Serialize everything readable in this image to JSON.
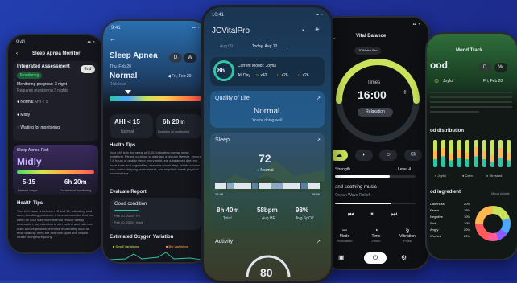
{
  "p1": {
    "title": "Sleep Apnea Monitor",
    "integrated": "Integrated Assessment",
    "end_btn": "End",
    "badge": "Monitoring",
    "progress": "Monitoring progress: 3 night",
    "progress_sub": "Requires monitoring 3 nights",
    "items": [
      "Normal",
      "Midly",
      "Waiting for monitoring"
    ],
    "item_note": "AHI < 5",
    "risk_label": "Sleep Apnea Risk",
    "risk_value": "Midly",
    "ahi_range": "5-15",
    "ahi_sub": "Interval range",
    "duration": "6h 20m",
    "duration_sub": "Duration of monitoring",
    "tips_title": "Health Tips",
    "tips_text": "Your AHI value is between 15 and 15, indicating mild sleep breathing problems. It is recommended that you sleep on your side more often to reduce airway obstruction; pay attention to diet control and eat more fruits and vegetables; exercise moderately such as brisk walking; keep the bedroom quiet and reduce health changes regularly."
  },
  "p2": {
    "title": "Sleep Apnea",
    "seg": [
      "D",
      "W"
    ],
    "date": "Thu, Feb 20",
    "status": "Normal",
    "date_nav": "Fri, Feb 20",
    "range_sub": "Risk level",
    "ahi": "AHI < 15",
    "ahi_sub": "Normal",
    "duration": "6h 20m",
    "duration_sub": "Duration of monitoring",
    "tips_title": "Health Tips",
    "tips_text": "Your AHI is in the range of 5-15, indicating normal sleep breathing. Please continue to maintain a regular lifestyle, ensure 7-8 hours of quality sleep every night, eat a balanced diet, eat more fruits and vegetables, exercise moderately, create a noise-free, warm sleeping environment, and regularly check physical examinations.",
    "eval_title": "Evaluate Report",
    "eval_status": "Good condition",
    "eval_dates": [
      "Feb 20, 2025 · Fri",
      "Feb 20, 2025 · Wed"
    ],
    "oxy_title": "Estimated Oxygen Variation",
    "legend": [
      "Small Variations",
      "Big Variations"
    ]
  },
  "p3": {
    "time": "10:41",
    "brand": "JCVitalPro",
    "tabs": [
      "Aug 09",
      "Today, Aug 10"
    ],
    "score": "86",
    "mood_label": "Current Mood : Joyful",
    "allday_label": "All Day",
    "mood_counts": [
      "x42",
      "x28",
      "x26"
    ],
    "qol_title": "Quality of Life",
    "qol_value": "Normal",
    "qol_sub": "You're doing well.",
    "sleep_title": "Sleep",
    "sleep_score": "72",
    "sleep_status": "Normal",
    "sleep_times": [
      "22:48",
      "08:56"
    ],
    "stats": [
      {
        "value": "8h 40m",
        "label": "Total"
      },
      {
        "value": "58bpm",
        "label": "Avg HR"
      },
      {
        "value": "98%",
        "label": "Avg SpO2"
      }
    ],
    "activity_title": "Activity",
    "activity_score": "80"
  },
  "p4": {
    "title": "Vital Balance",
    "chip": "JCWatch Pro",
    "mode": "Times",
    "time": "16:00",
    "relax_btn": "Relaxation",
    "strength_label": "Strength",
    "strength_level": "Level 4",
    "music_title": "and soothing music",
    "music_sub": "Ocean Wave Relief",
    "modes": [
      {
        "label": "Mode",
        "value": "Relaxation"
      },
      {
        "label": "Time",
        "value": "20min"
      },
      {
        "label": "Vibration",
        "value": "Pulse"
      }
    ]
  },
  "p5": {
    "title": "Mood Track",
    "mood_title": "ood",
    "seg": [
      "D",
      "W"
    ],
    "mood_label": "Joyful",
    "date": "Fri, Feb 20",
    "dist_title": "od distribution",
    "dist_legend": [
      "Joyful",
      "Calm",
      "Stressed"
    ],
    "ingredient_title": "od ingredient",
    "ingredient_link": "Mood details",
    "ingredients": [
      {
        "label": "Calmness",
        "value": "20%"
      },
      {
        "label": "Peace",
        "value": "15%"
      },
      {
        "label": "Negative",
        "value": "10%"
      },
      {
        "label": "Sad",
        "value": "10%"
      },
      {
        "label": "Angry",
        "value": "20%"
      },
      {
        "label": "Worried",
        "value": "20%"
      }
    ]
  },
  "colors": {
    "accent_green": "#c9e35a",
    "accent_blue": "#4da8ff",
    "teal": "#2ec4a6",
    "bg_dark": "#14161c"
  }
}
